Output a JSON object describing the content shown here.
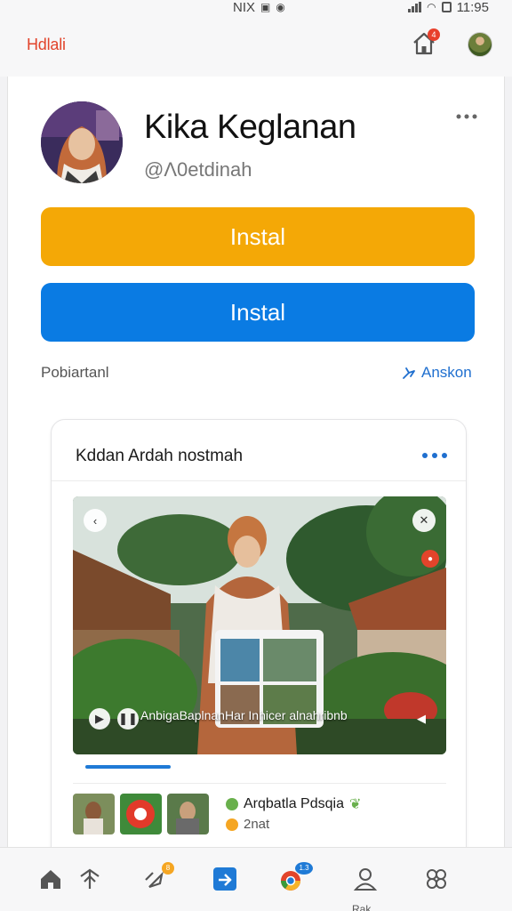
{
  "status_bar": {
    "carrier_text": "NIX",
    "time": "11:95"
  },
  "app_bar": {
    "brand": "Hdlali",
    "notification_count": "4"
  },
  "profile": {
    "name": "Kika Keglanan",
    "handle": "@Λ0etdinah"
  },
  "buttons": {
    "primary_label": "Instal",
    "secondary_label": "Instal"
  },
  "section": {
    "label": "Pobiartanl",
    "action_label": "Anskon"
  },
  "post": {
    "title": "Kddan Ardah nostmah",
    "photo_caption": "AnbigaBaplnanHar Inhicer alnahribnb",
    "author": "Arqbatla Pdsqia",
    "sub": "2nat"
  },
  "bottom_nav": {
    "items": [
      "home-icon",
      "share-icon",
      "hand-icon",
      "app-icon",
      "chrome-icon",
      "person-icon",
      "group-icon"
    ],
    "badge_one": "8",
    "badge_two": "1.3",
    "label": "Rak"
  },
  "colors": {
    "brand": "#e2442b",
    "yellow_button": "#f4a806",
    "blue_button": "#0a7be3",
    "link": "#1f6fcf"
  }
}
